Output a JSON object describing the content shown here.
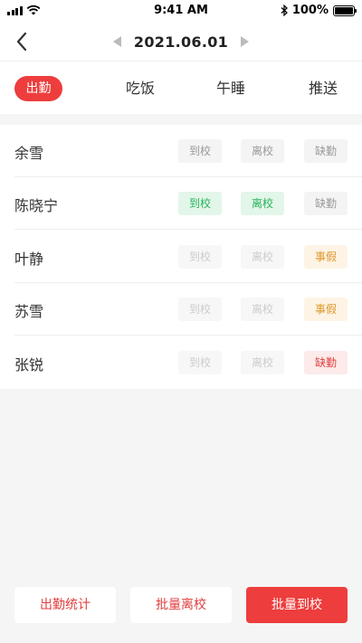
{
  "status_bar": {
    "time": "9:41 AM",
    "battery": "100%"
  },
  "header": {
    "date": "2021.06.01"
  },
  "tabs": [
    {
      "label": "出勤",
      "active": true
    },
    {
      "label": "吃饭",
      "active": false
    },
    {
      "label": "午睡",
      "active": false
    },
    {
      "label": "推送",
      "active": false
    }
  ],
  "students": [
    {
      "name": "余雪",
      "arrive": "到校",
      "leave": "离校",
      "absent": "缺勤"
    },
    {
      "name": "陈晓宁",
      "arrive": "到校",
      "leave": "离校",
      "absent": "缺勤"
    },
    {
      "name": "叶静",
      "arrive": "到校",
      "leave": "离校",
      "absent": "事假"
    },
    {
      "name": "苏雪",
      "arrive": "到校",
      "leave": "离校",
      "absent": "事假"
    },
    {
      "name": "张锐",
      "arrive": "到校",
      "leave": "离校",
      "absent": "缺勤"
    }
  ],
  "footer": {
    "stats_label": "出勤统计",
    "batch_leave_label": "批量离校",
    "batch_arrive_label": "批量到校"
  },
  "colors": {
    "accent": "#ee3d3d",
    "green": "#27b35a",
    "orange": "#e0962a"
  }
}
